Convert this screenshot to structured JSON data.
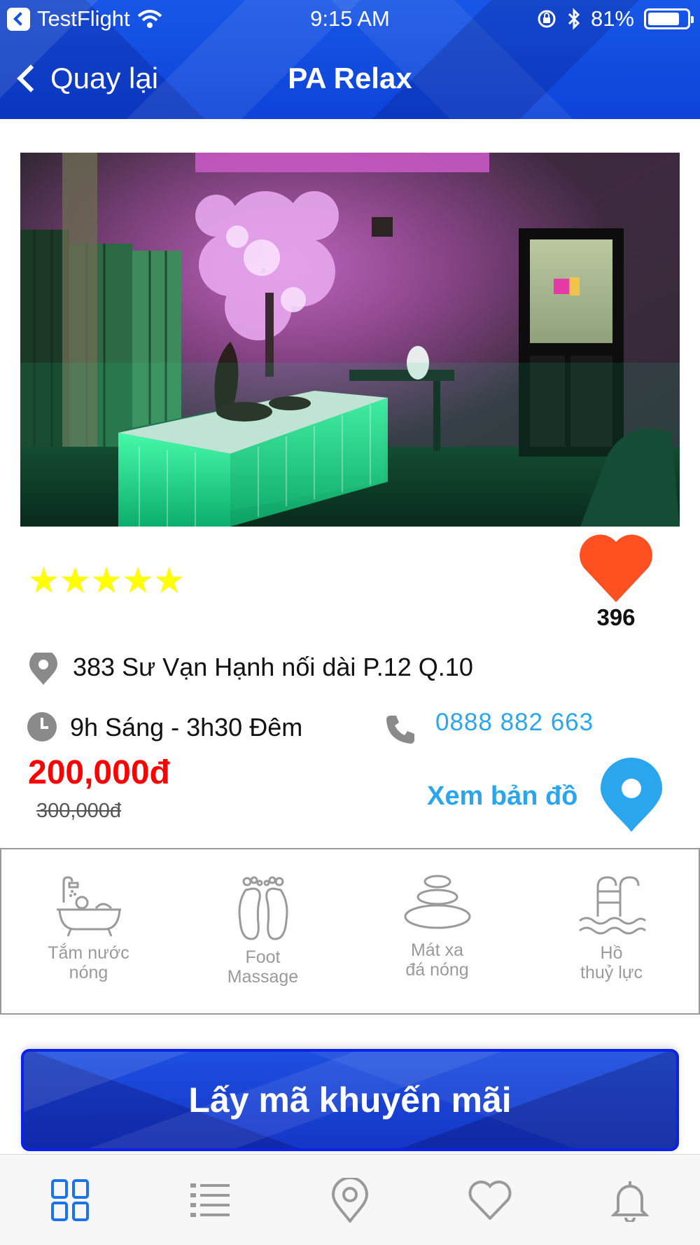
{
  "status_bar": {
    "carrier": "TestFlight",
    "time": "9:15 AM",
    "battery": "81%",
    "battery_level": 0.81
  },
  "nav": {
    "back_label": "Quay lại",
    "title": "PA Relax"
  },
  "listing": {
    "rating_stars": 5,
    "stars_text": "★★★★★",
    "favorite_count": "396",
    "address": "383 Sư Vạn Hạnh nối dài P.12 Q.10",
    "hours": "9h Sáng - 3h30 Đêm",
    "phone": "0888 882 663",
    "price_new": "200,000đ",
    "price_old": "300,000đ",
    "map_link": "Xem bản đồ"
  },
  "amenities": [
    {
      "icon": "bathtub-icon",
      "label": "Tắm nước\nnóng"
    },
    {
      "icon": "feet-icon",
      "label": "Foot\nMassage"
    },
    {
      "icon": "hot-stones-icon",
      "label": "Mát xa\nđá nóng"
    },
    {
      "icon": "pool-ladder-icon",
      "label": "Hồ\nthuỷ lực"
    }
  ],
  "promo_button": "Lấy mã khuyến mãi",
  "tabbar": [
    {
      "icon": "grid-icon",
      "active": true
    },
    {
      "icon": "list-icon",
      "active": false
    },
    {
      "icon": "location-icon",
      "active": false
    },
    {
      "icon": "heart-icon",
      "active": false
    },
    {
      "icon": "bell-icon",
      "active": false
    }
  ],
  "colors": {
    "header_blue": "#0d43d9",
    "price_red": "#ff0000",
    "link_blue": "#2aa6ee",
    "heart_orange": "#ff5022",
    "star_yellow": "#ffff00",
    "tab_active": "#1a73e8",
    "tab_inactive": "#9a9a9a"
  }
}
